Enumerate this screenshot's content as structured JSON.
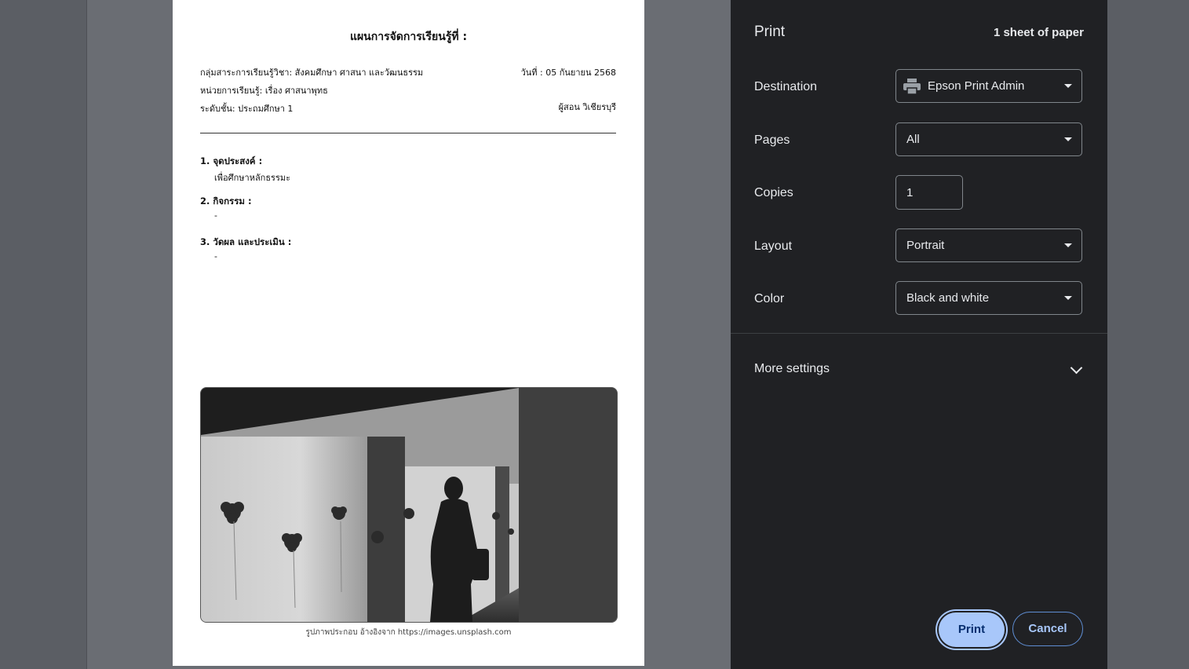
{
  "document": {
    "title": "แผนการจัดการเรียนรู้ที่ :",
    "subject": "กลุ่มสาระการเรียนรู้วิชา: สังคมศึกษา ศาสนา และวัฒนธรรม",
    "date": "วันที่ : 05 กันยายน 2568",
    "unit": "หน่วยการเรียนรู้: เรื่อง ศาสนาพุทธ",
    "level": "ระดับชั้น: ประถมศึกษา 1",
    "teacher": "ผู้สอน วิเชียรบุรี",
    "sections": [
      {
        "heading": "1. จุดประสงค์ :",
        "body": "เพื่อศึกษาหลักธรรมะ"
      },
      {
        "heading": "2. กิจกรรม :",
        "body": "-"
      },
      {
        "heading": "3. วัดผล และประเมิน :",
        "body": "-"
      }
    ],
    "caption": "รูปภาพประกอบ อ้างอิงจาก https://images.unsplash.com"
  },
  "print_panel": {
    "title": "Print",
    "sheet_count": "1 sheet of paper",
    "destination_label": "Destination",
    "destination_value": "Epson Print Admin",
    "pages_label": "Pages",
    "pages_value": "All",
    "copies_label": "Copies",
    "copies_value": "1",
    "layout_label": "Layout",
    "layout_value": "Portrait",
    "color_label": "Color",
    "color_value": "Black and white",
    "more_settings": "More settings",
    "print_button": "Print",
    "cancel_button": "Cancel"
  },
  "colors": {
    "panel_bg": "#202124",
    "accent": "#a8c7fa"
  }
}
